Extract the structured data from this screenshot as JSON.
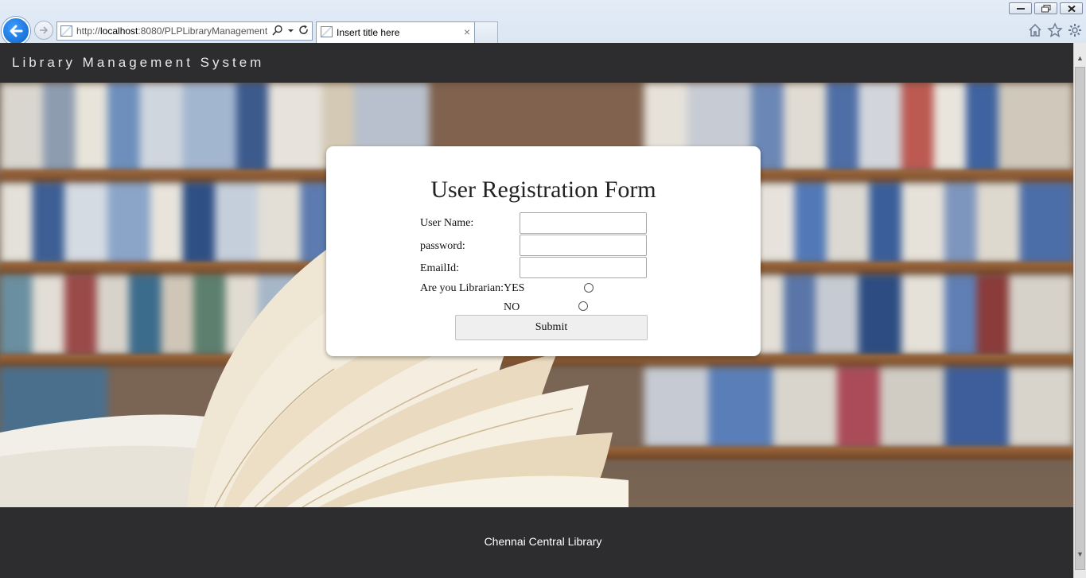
{
  "browser": {
    "url_prefix": "http://",
    "url_host": "localhost",
    "url_rest": ":8080/PLPLibraryManagement",
    "tab_title": "Insert title here",
    "tab_close": "×"
  },
  "header": {
    "brand": "Library Management System"
  },
  "form": {
    "title": "User Registration Form",
    "username_label": "User Name:",
    "password_label": "password:",
    "email_label": "EmailId:",
    "librarian_label": "Are you Librarian:",
    "yes_label": "YES",
    "no_label": "NO",
    "submit_label": "Submit"
  },
  "footer": {
    "text": "Chennai Central Library"
  }
}
